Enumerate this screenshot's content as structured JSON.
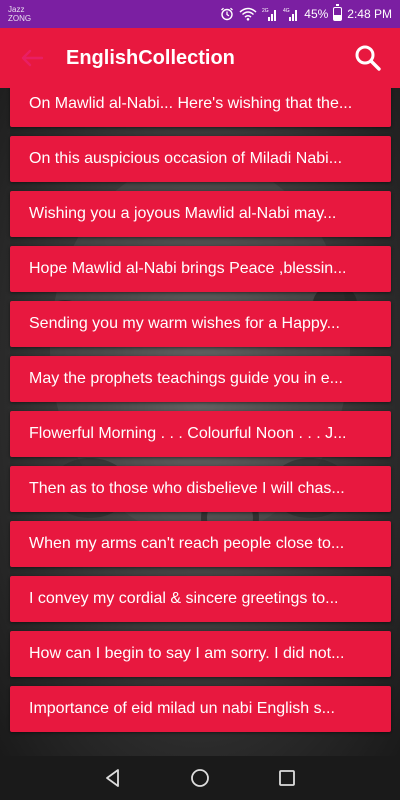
{
  "status_bar": {
    "carrier_line1": "Jazz",
    "carrier_line2": "ZONG",
    "battery_percent": "45%",
    "battery_level": 0.45,
    "time": "2:48 PM",
    "network_label_1": "2G",
    "network_label_2": "4G",
    "icons": [
      "alarm-icon",
      "wifi-icon",
      "signal-icon",
      "battery-icon"
    ],
    "color": "#7b1fa2"
  },
  "app_bar": {
    "title": "EnglishCollection",
    "back_icon": "back-arrow-icon",
    "search_icon": "search-icon",
    "color": "#e8183f",
    "back_icon_color": "#e91e63"
  },
  "messages": [
    "On Mawlid al-Nabi... Here's wishing that the...",
    "On this auspicious occasion of Miladi Nabi...",
    " Wishing you a joyous Mawlid al-Nabi may...",
    "Hope Mawlid al-Nabi brings Peace ,blessin...",
    "Sending you my warm wishes for a Happy...",
    "May the prophets teachings guide you in e...",
    "Flowerful Morning . . . Colourful Noon . . . J...",
    "Then as to those who disbelieve I will chas...",
    "When my arms can't reach people close to...",
    "I convey my cordial & sincere greetings to...",
    "How can I begin to say I am sorry. I did not...",
    "Importance of eid milad un nabi English s..."
  ],
  "nav_bar": {
    "buttons": [
      "back-triangle-icon",
      "home-circle-icon",
      "recents-square-icon"
    ]
  }
}
